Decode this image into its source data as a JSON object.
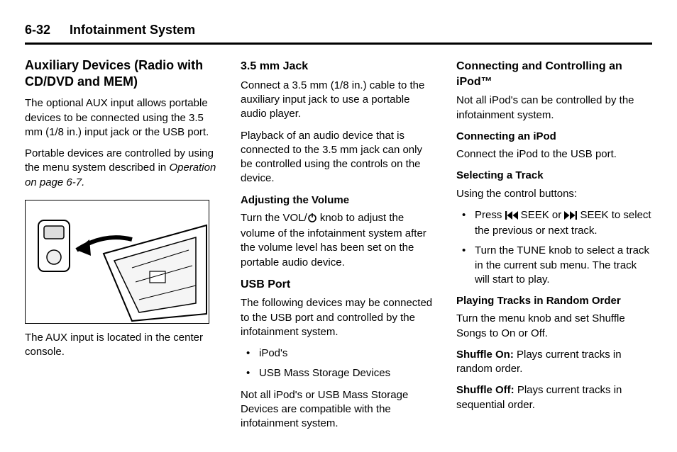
{
  "header": {
    "page_number": "6-32",
    "title": "Infotainment System"
  },
  "col1": {
    "h2": "Auxiliary Devices (Radio with CD/DVD and MEM)",
    "p1": "The optional AUX input allows portable devices to be connected using the 3.5 mm (1/8 in.) input jack or the USB port.",
    "p2a": "Portable devices are controlled by using the menu system described in ",
    "p2b": "Operation on page 6-7.",
    "caption": "The AUX input is located in the center console."
  },
  "col2": {
    "h3a": "3.5 mm Jack",
    "p1": "Connect a 3.5 mm (1/8 in.) cable to the auxiliary input jack to use a portable audio player.",
    "p2": "Playback of an audio device that is connected to the 3.5 mm jack can only be controlled using the controls on the device.",
    "h4a": "Adjusting the Volume",
    "p3a": "Turn the VOL/",
    "p3b": " knob to adjust the volume of the infotainment system after the volume level has been set on the portable audio device.",
    "h3b": "USB Port",
    "p4": "The following devices may be connected to the USB port and controlled by the infotainment system.",
    "li1": "iPod's",
    "li2": "USB Mass Storage Devices",
    "p5": "Not all iPod's or USB Mass Storage Devices are compatible with the infotainment system."
  },
  "col3": {
    "h3a": "Connecting and Controlling an iPod™",
    "p1": "Not all iPod's can be controlled by the infotainment system.",
    "h4a": "Connecting an iPod",
    "p2": "Connect the iPod to the USB port.",
    "h4b": "Selecting a Track",
    "p3": "Using the control buttons:",
    "li1a": "Press ",
    "li1b": " SEEK or ",
    "li1c": " SEEK to select the previous or next track.",
    "li2": "Turn the TUNE knob to select a track in the current sub menu. The track will start to play.",
    "h4c": "Playing Tracks in Random Order",
    "p4": "Turn the menu knob and set Shuffle Songs to On or Off.",
    "p5_label": "Shuffle On:",
    "p5_text": "  Plays current tracks in random order.",
    "p6_label": "Shuffle Off:",
    "p6_text": "  Plays current tracks in sequential order."
  }
}
